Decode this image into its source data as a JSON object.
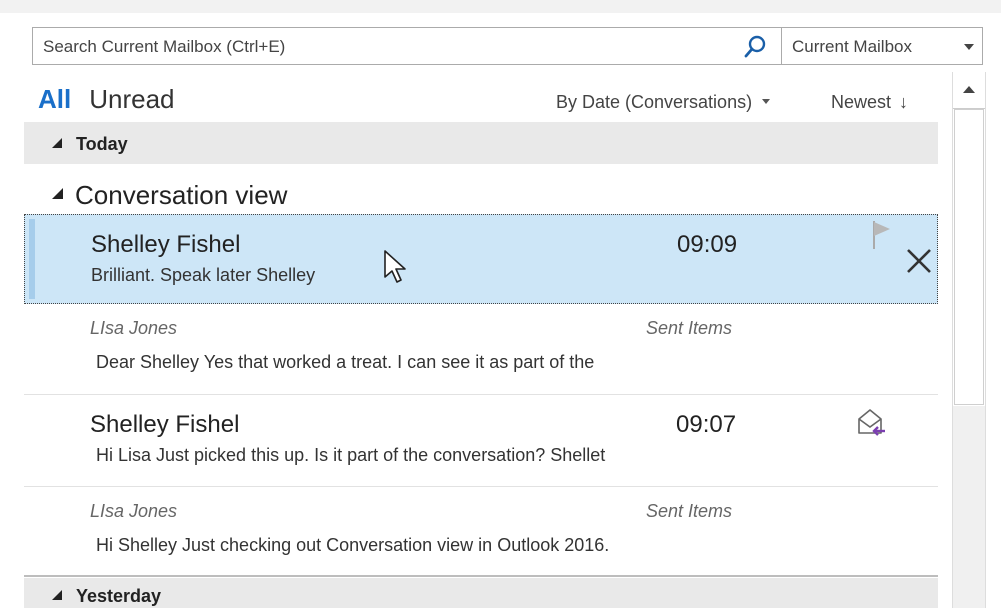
{
  "search": {
    "placeholder": "Search Current Mailbox (Ctrl+E)",
    "scope": "Current Mailbox"
  },
  "filters": {
    "all": "All",
    "unread": "Unread"
  },
  "sort": {
    "arrangement": "By Date (Conversations)",
    "order": "Newest",
    "order_arrow": "↓"
  },
  "groups": {
    "today": "Today",
    "yesterday": "Yesterday"
  },
  "conversation": {
    "title": "Conversation view",
    "messages": [
      {
        "sender": "Shelley Fishel",
        "time": "09:09",
        "preview": "Brilliant.  Speak later  Shelley"
      },
      {
        "sender": "LIsa Jones",
        "folder": "Sent Items",
        "preview": "Dear Shelley  Yes that worked a treat. I can see it as part of the"
      },
      {
        "sender": "Shelley Fishel",
        "time": "09:07",
        "preview": "Hi Lisa  Just picked this up. Is it part of the conversation?  Shellet"
      },
      {
        "sender": "LIsa Jones",
        "folder": "Sent Items",
        "preview": "Hi Shelley  Just checking out Conversation view in Outlook 2016."
      }
    ]
  },
  "colors": {
    "accent": "#1a6fc9",
    "selected_bg": "#cde6f7",
    "group_bg": "#e9e9e9",
    "reply_icon": "#7b3fb0"
  }
}
